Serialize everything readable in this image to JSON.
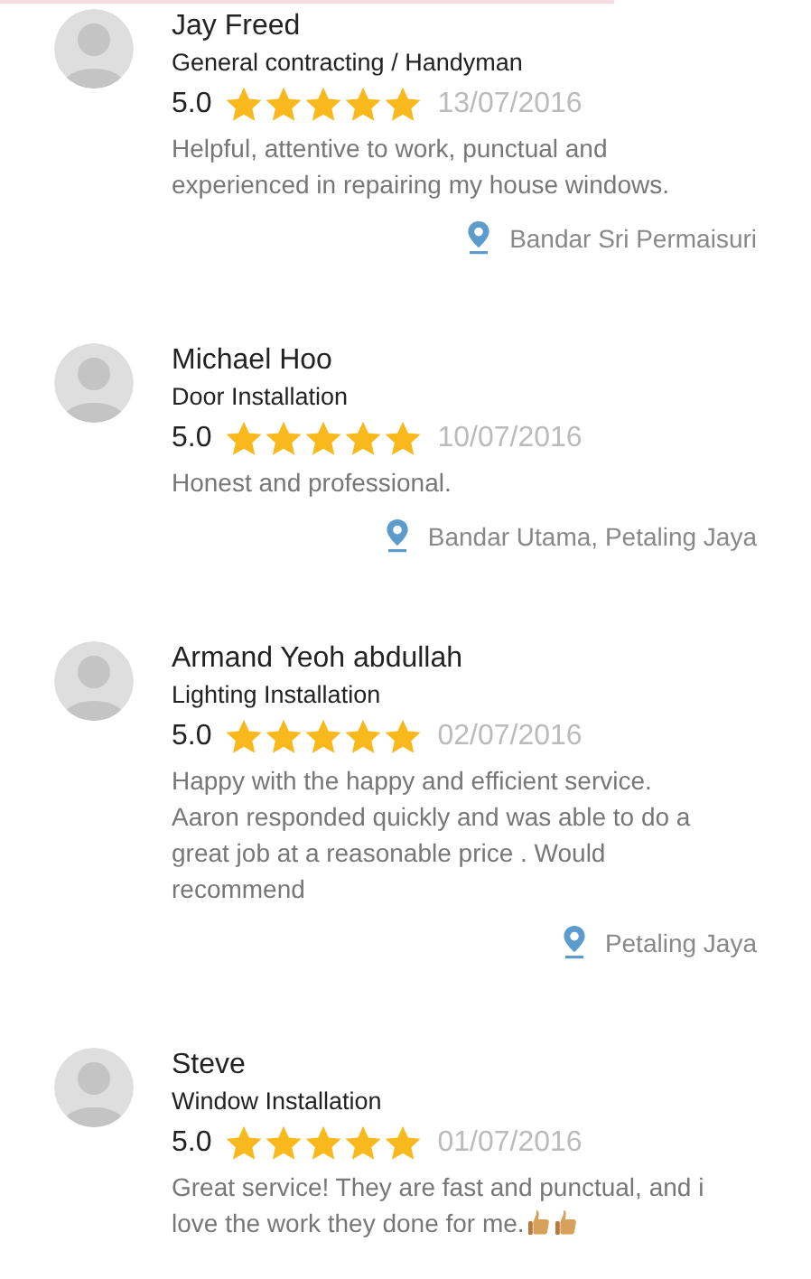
{
  "reviews": [
    {
      "name": "Jay Freed",
      "category": "General contracting / Handyman",
      "score": "5.0",
      "stars": 5,
      "date": "13/07/2016",
      "comment": "Helpful, attentive to work, punctual and experienced in repairing my house windows.",
      "location": "Bandar Sri Permaisuri"
    },
    {
      "name": "Michael Hoo",
      "category": "Door Installation",
      "score": "5.0",
      "stars": 5,
      "date": "10/07/2016",
      "comment": "Honest and professional.",
      "location": "Bandar Utama, Petaling Jaya"
    },
    {
      "name": "Armand Yeoh abdullah",
      "category": "Lighting Installation",
      "score": "5.0",
      "stars": 5,
      "date": "02/07/2016",
      "comment": "Happy with the happy and efficient service. Aaron responded quickly and was able to do a great job at a reasonable price . Would recommend",
      "location": "Petaling Jaya"
    },
    {
      "name": "Steve",
      "category": "Window Installation",
      "score": "5.0",
      "stars": 5,
      "date": "01/07/2016",
      "comment": "Great service! They are fast and punctual, and i love the work they done for me.",
      "reactions": [
        {
          "kind": "thumbs-up"
        },
        {
          "kind": "thumbs-up"
        }
      ]
    }
  ]
}
